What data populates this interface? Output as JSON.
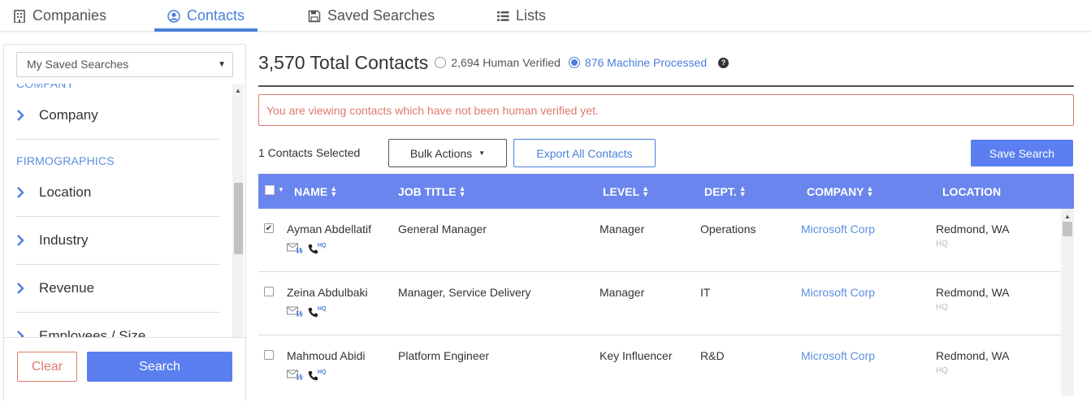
{
  "nav": {
    "tabs": [
      {
        "label": "Companies",
        "icon": "building-icon"
      },
      {
        "label": "Contacts",
        "icon": "user-circle-icon",
        "active": true
      },
      {
        "label": "Saved Searches",
        "icon": "floppy-icon"
      },
      {
        "label": "Lists",
        "icon": "list-icon"
      }
    ]
  },
  "sidebar": {
    "saved_select": "My Saved Searches",
    "section_company": "COMPANY",
    "section_firmographics": "FIRMOGRAPHICS",
    "items": [
      "Company",
      "Location",
      "Industry",
      "Revenue",
      "Employees / Size"
    ],
    "clear_label": "Clear",
    "search_label": "Search"
  },
  "summary": {
    "total": "3,570 Total Contacts",
    "human_verified": "2,694 Human Verified",
    "machine_processed": "876 Machine Processed",
    "selected_filter": "machine_processed"
  },
  "alert": "You are viewing contacts which have not been human verified yet.",
  "toolbar": {
    "selected_count": "1 Contacts Selected",
    "bulk_actions": "Bulk Actions",
    "export_all": "Export All Contacts",
    "save_search": "Save Search"
  },
  "table": {
    "columns": [
      "NAME",
      "JOB TITLE",
      "LEVEL",
      "DEPT.",
      "COMPANY",
      "LOCATION"
    ],
    "rows": [
      {
        "checked": true,
        "name": "Ayman Abdellatif",
        "title": "General Manager",
        "level": "Manager",
        "dept": "Operations",
        "company": "Microsoft Corp",
        "location": "Redmond, WA",
        "hq": "HQ",
        "phone_badge": "HQ"
      },
      {
        "checked": false,
        "name": "Zeina Abdulbaki",
        "title": "Manager, Service Delivery",
        "level": "Manager",
        "dept": "IT",
        "company": "Microsoft Corp",
        "location": "Redmond, WA",
        "hq": "HQ",
        "phone_badge": "HQ"
      },
      {
        "checked": false,
        "name": "Mahmoud Abidi",
        "title": "Platform Engineer",
        "level": "Key Influencer",
        "dept": "R&D",
        "company": "Microsoft Corp",
        "location": "Redmond, WA",
        "hq": "HQ",
        "phone_badge": "HQ"
      }
    ]
  },
  "colors": {
    "accent": "#4a7fdc",
    "header": "#6a85ee",
    "alert": "#e07a6b",
    "primary_button": "#5b7ff0"
  }
}
